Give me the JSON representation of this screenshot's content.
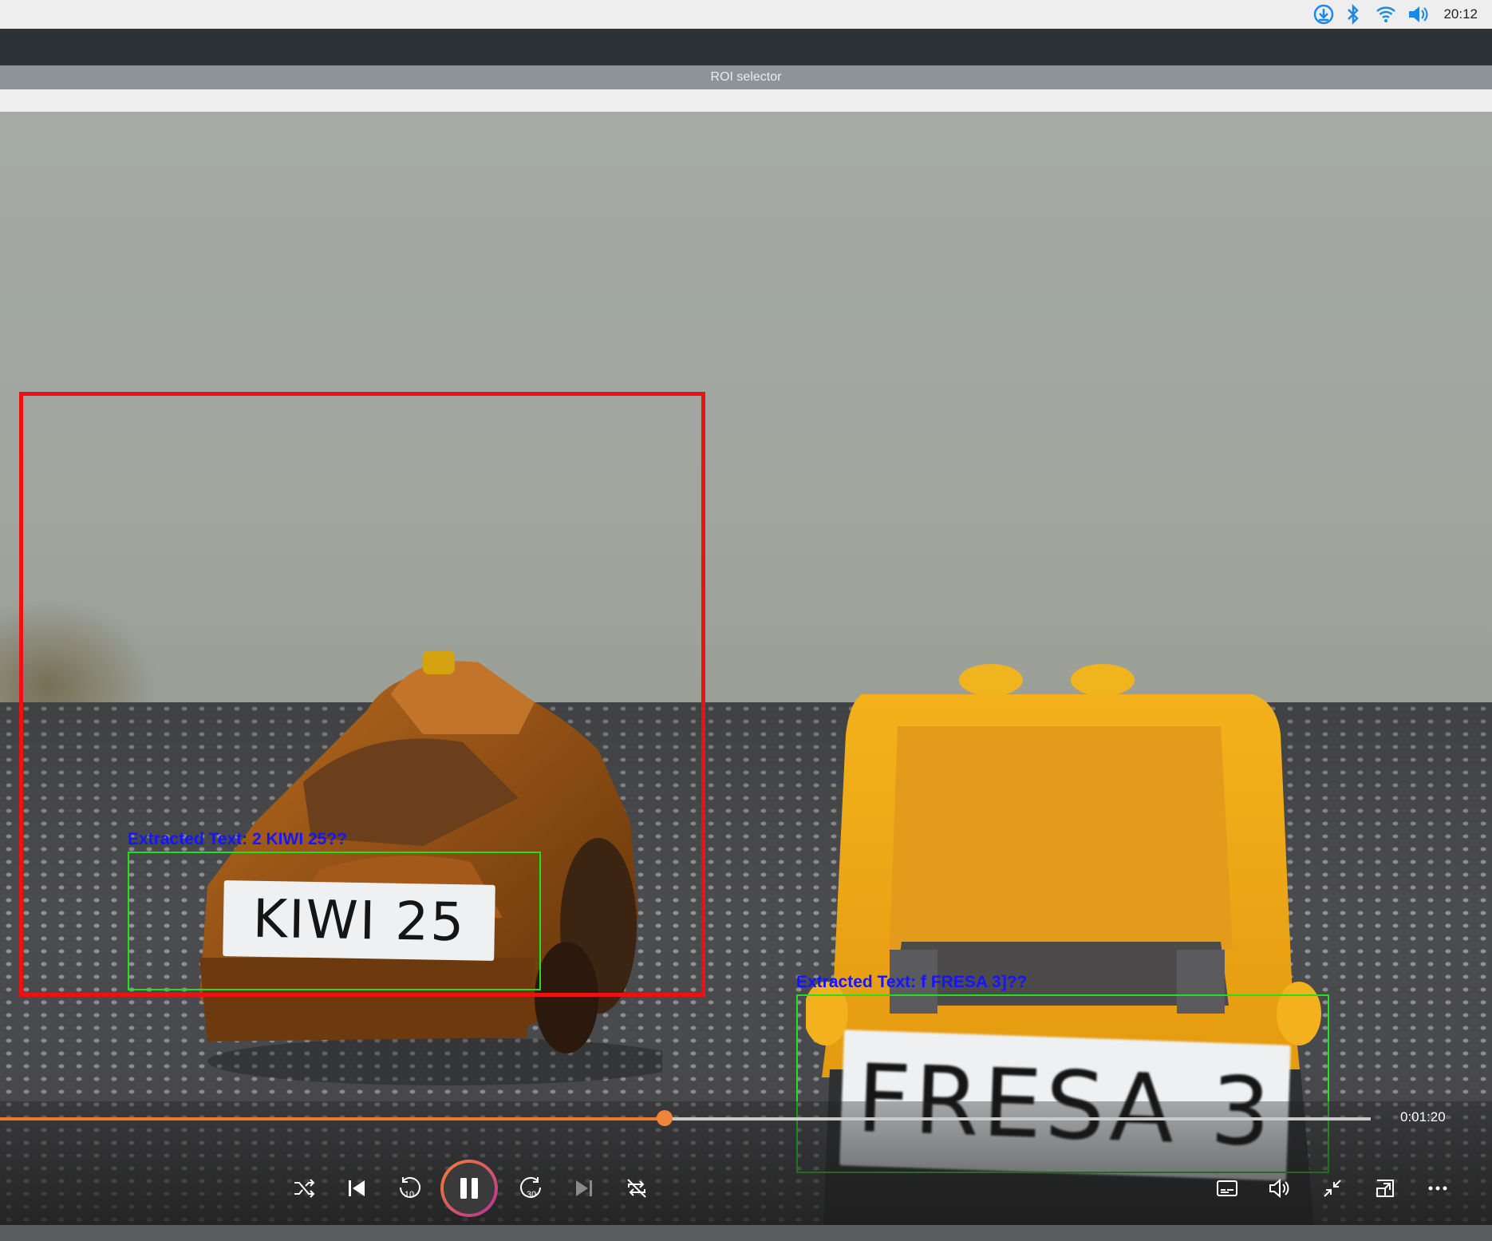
{
  "system_tray": {
    "icons": [
      "download-icon",
      "bluetooth-icon",
      "wifi-icon",
      "volume-icon"
    ],
    "clock": "20:12"
  },
  "window": {
    "title": "ROI selector"
  },
  "video": {
    "plates": {
      "kiwi": "KIWI 25",
      "fresa": "FRESA 3"
    },
    "detections": [
      {
        "label": "Extracted Text: 2 KIWI 25??"
      },
      {
        "label": "Extracted Text: f FRESA 3]??"
      }
    ],
    "colors": {
      "roi_box": "#ee1111",
      "detection_box": "#20e020",
      "detection_text": "#1515ff"
    }
  },
  "player": {
    "progress": 0.485,
    "time": "0:01:20",
    "accent": "#ee7a2d",
    "buttons": [
      "shuffle-icon",
      "previous-icon",
      "rewind-10-icon",
      "pause-icon",
      "forward-30-icon",
      "next-icon",
      "repeat-off-icon",
      "subtitles-icon",
      "volume-icon",
      "exit-fullscreen-icon",
      "mini-view-icon",
      "more-icon"
    ],
    "rewind_label": "10",
    "forward_label": "30"
  }
}
